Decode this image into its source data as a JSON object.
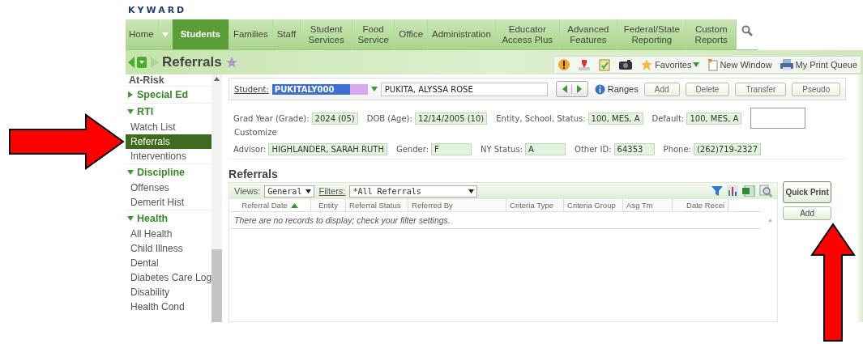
{
  "logo": "KYWARD",
  "nav": [
    {
      "label": "Home",
      "selected": false,
      "has_menu": true
    },
    {
      "label": "Students",
      "selected": true
    },
    {
      "label": "Families",
      "selected": false
    },
    {
      "label": "Staff",
      "selected": false
    },
    {
      "label": "Student Services",
      "selected": false
    },
    {
      "label": "Food Service",
      "selected": false
    },
    {
      "label": "Office",
      "selected": false
    },
    {
      "label": "Administration",
      "selected": false
    },
    {
      "label": "Educator Access Plus",
      "selected": false
    },
    {
      "label": "Advanced Features",
      "selected": false
    },
    {
      "label": "Federal/State Reporting",
      "selected": false
    },
    {
      "label": "Custom Reports",
      "selected": false
    }
  ],
  "page_title": "Referrals",
  "toolbar": {
    "favorites": "Favorites",
    "new_window": "New Window",
    "print_queue": "My Print Queue"
  },
  "sidebar": {
    "groups": [
      {
        "label": "At-Risk"
      },
      {
        "label": "Special Ed",
        "expanded": false
      },
      {
        "label": "RTI",
        "expanded": true,
        "children": [
          {
            "label": "Watch List",
            "selected": false
          },
          {
            "label": "Referrals",
            "selected": true
          },
          {
            "label": "Interventions",
            "selected": false
          }
        ]
      },
      {
        "label": "Discipline",
        "expanded": true,
        "children": [
          {
            "label": "Offenses",
            "selected": false
          },
          {
            "label": "Demerit Hist",
            "selected": false
          }
        ]
      },
      {
        "label": "Health",
        "expanded": true,
        "children": [
          {
            "label": "All Health",
            "selected": false
          },
          {
            "label": "Child Illness",
            "selected": false
          },
          {
            "label": "Dental",
            "selected": false
          },
          {
            "label": "Diabetes Care Log",
            "selected": false
          },
          {
            "label": "Disability",
            "selected": false
          },
          {
            "label": "Health Cond",
            "selected": false
          }
        ]
      }
    ]
  },
  "student": {
    "label": "Student:",
    "id": "PUKITALY000",
    "name": "PUKITA, ALYSSA ROSE",
    "ranges": "Ranges",
    "buttons": [
      "Add",
      "Delete",
      "Transfer",
      "Pseudo"
    ]
  },
  "info_rows": [
    {
      "trailing_box": true,
      "fields": [
        {
          "label": "Grad Year (Grade):",
          "value": "2024 (05)"
        },
        {
          "label": "DOB (Age):",
          "value": "12/14/2005 (10)"
        },
        {
          "label": "Entity, School, Status:",
          "value": "100, MES, A"
        },
        {
          "label": "Default:",
          "value": "100, MES, A"
        }
      ]
    },
    {
      "trailing_box": false,
      "fields": [
        {
          "label": "Advisor:",
          "value": "HIGHLANDER, SARAH RUTH"
        },
        {
          "label": "Gender:",
          "value": "F"
        },
        {
          "label": "NY Status:",
          "value": "A"
        },
        {
          "label": "Other ID:",
          "value": "64353"
        },
        {
          "label": "Phone:",
          "value": "(262)719-2327"
        }
      ]
    }
  ],
  "customize": "Customize",
  "section_title": "Referrals",
  "grid": {
    "views_label": "Views:",
    "view": "General",
    "filters_label": "Filters:",
    "filter": "*All Referrals",
    "columns": [
      {
        "label": "Referral Date",
        "sorted": true
      },
      {
        "label": "Entity",
        "sorted": false
      },
      {
        "label": "Referral Status",
        "sorted": false
      },
      {
        "label": "Referred By",
        "sorted": false
      },
      {
        "label": "Criteria Type",
        "sorted": false
      },
      {
        "label": "Criteria Group",
        "sorted": false
      },
      {
        "label": "Asg Tm",
        "sorted": false
      },
      {
        "label": "Date Recei",
        "sorted": false
      }
    ],
    "empty_message": "There are no records to display; check your filter settings."
  },
  "side_buttons": [
    "Quick Print",
    "Add"
  ],
  "annotations": [
    {
      "kind": "arrow"
    },
    {
      "kind": "arrow"
    }
  ]
}
